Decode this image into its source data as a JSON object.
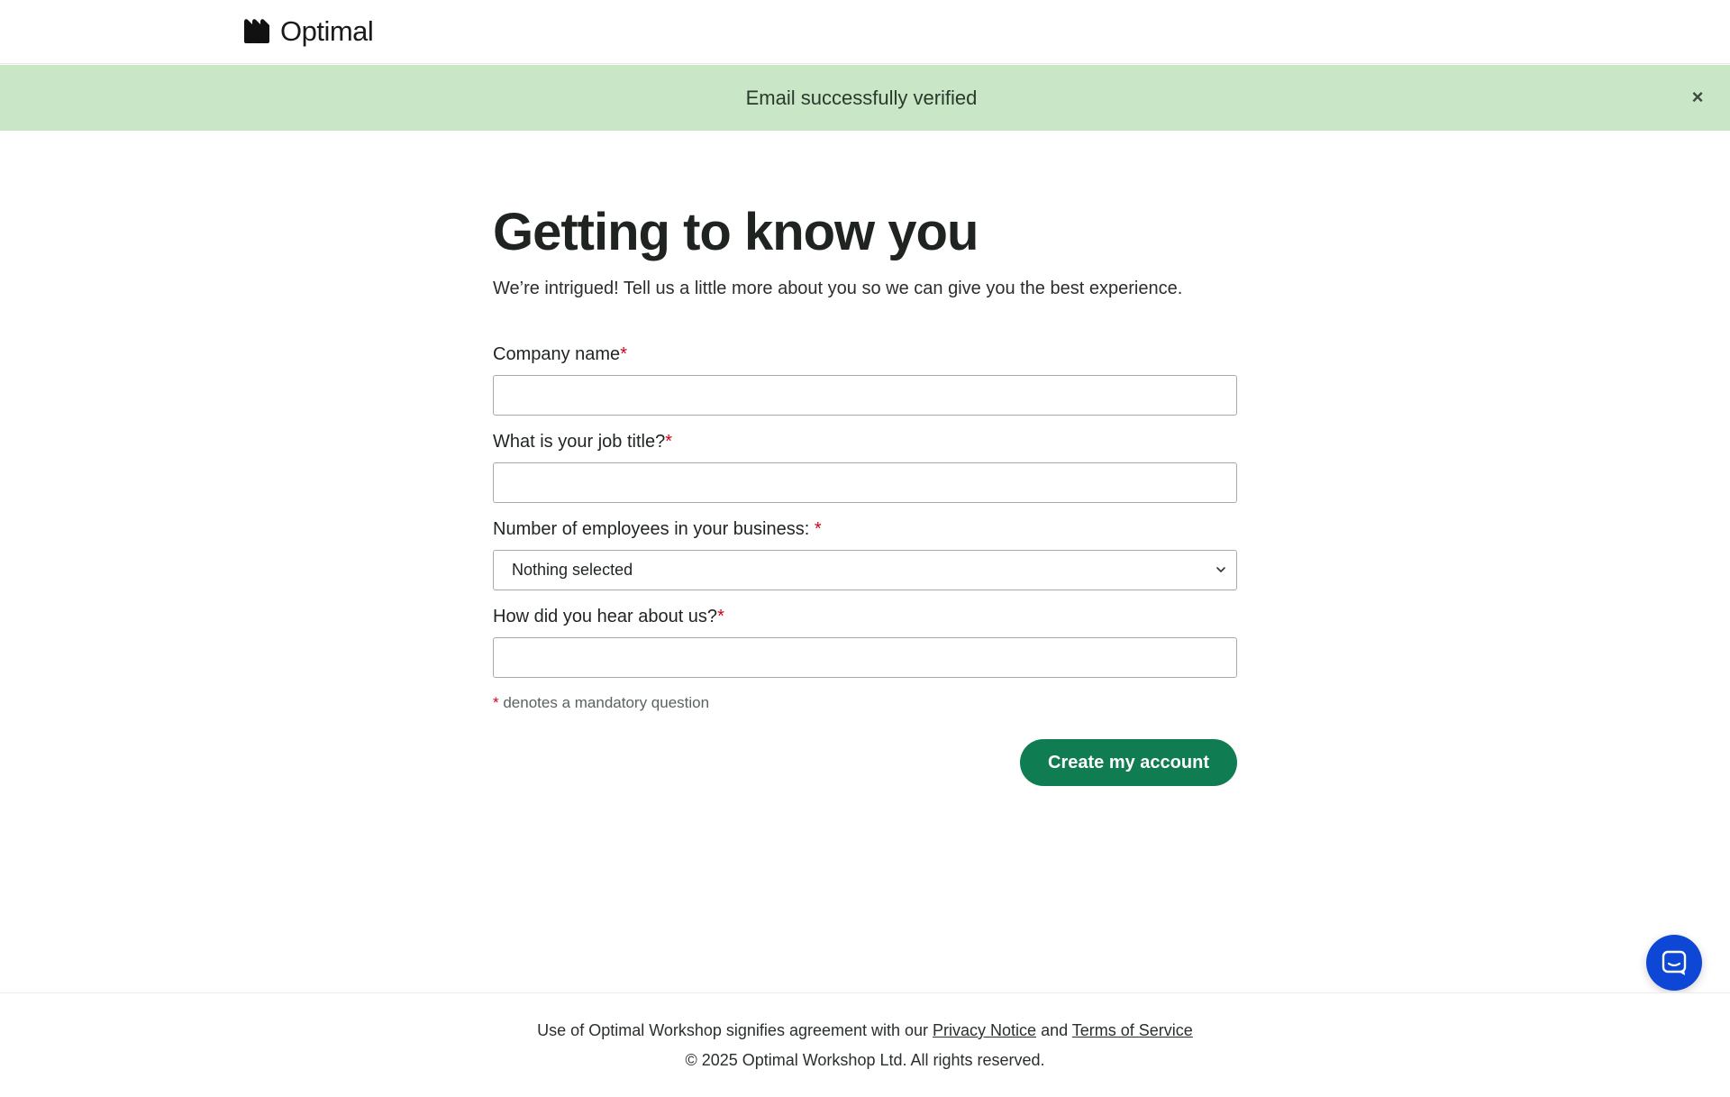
{
  "header": {
    "logo_text": "Optimal"
  },
  "banner": {
    "message": "Email successfully verified",
    "close_label": "×",
    "background_color": "#c9e6c6"
  },
  "main": {
    "title": "Getting to know you",
    "subtitle": "We’re intrigued! Tell us a little more about you so we can give you the best experience.",
    "fields": [
      {
        "label": "Company name",
        "required_mark": "*",
        "value": "",
        "placeholder": ""
      },
      {
        "label": "What is your job title?",
        "required_mark": "*",
        "value": "",
        "placeholder": ""
      },
      {
        "label": "Number of employees in your business: ",
        "required_mark": "*",
        "selected_value": "Nothing selected"
      },
      {
        "label": "How did you hear about us?",
        "required_mark": "*",
        "value": "",
        "placeholder": ""
      }
    ],
    "legend_mark": "*",
    "legend_text": " denotes a mandatory question",
    "submit_label": "Create my account",
    "submit_color": "#107c52"
  },
  "footer": {
    "line1_prefix": "Use of Optimal Workshop signifies agreement with our ",
    "privacy_link": "Privacy Notice",
    "line1_middle": " and ",
    "terms_link": "Terms of Service",
    "copyright": "© 2025 Optimal Workshop Ltd. All rights reserved."
  },
  "chat": {
    "icon": "chat-bubble-icon",
    "color": "#0e47d6"
  }
}
